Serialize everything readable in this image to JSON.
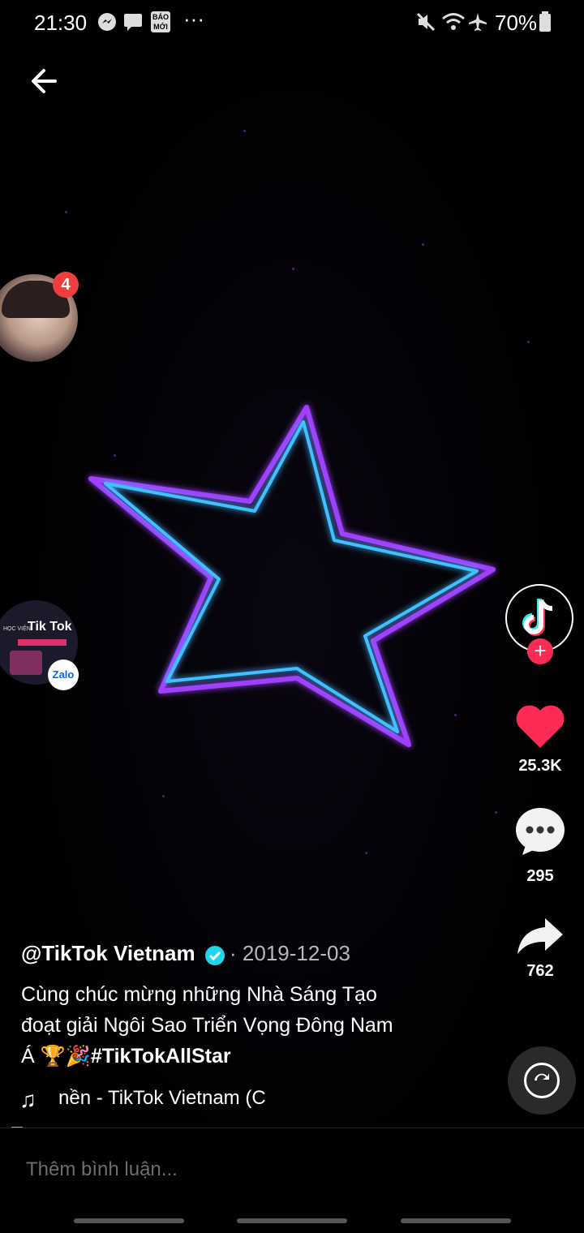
{
  "status_bar": {
    "time": "21:30",
    "notification_icons": [
      "messenger-icon",
      "message-icon",
      "bao-moi-icon",
      "more-icon"
    ],
    "bao_moi_text": "BÁO MỚI",
    "more": "···",
    "battery": "70%"
  },
  "floating": {
    "chat_badge_count": "4",
    "tiktok_bubble_title": "Tik Tok",
    "tiktok_bubble_prefix": "HỌC VIỆN",
    "zalo_label": "Zalo"
  },
  "actions": {
    "likes": "25.3K",
    "comments": "295",
    "shares": "762"
  },
  "video": {
    "author": "@TikTok Vietnam",
    "separator": "·",
    "date": "2019-12-03",
    "caption_line1": "Cùng chúc mừng những Nhà Sáng Tạo",
    "caption_line2": "đoạt giải Ngôi Sao Triển Vọng Đông Nam",
    "caption_line3_prefix": "Á 🏆🎉",
    "hashtag": "#TikTokAllStar",
    "music": "nền - TikTok Vietnam (C"
  },
  "comment_input": {
    "placeholder": "Thêm bình luận..."
  },
  "colors": {
    "like": "#fe2c55",
    "accent": "#fe2c55",
    "verified": "#20d5ec",
    "star_outer": "#a040ff",
    "star_inner": "#40c0ff"
  }
}
